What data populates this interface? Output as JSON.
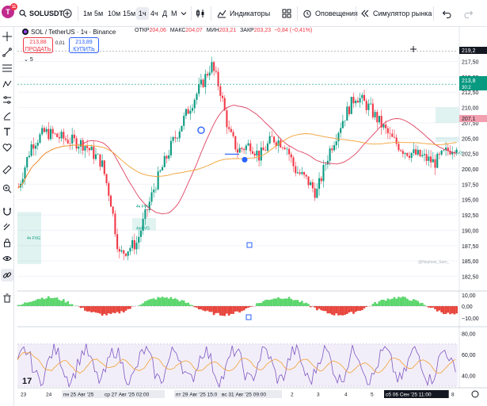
{
  "topbar": {
    "avatar_letter": "T",
    "badge": "11",
    "symbol": "SOLUSDT",
    "intervals": [
      "1м",
      "5м",
      "10м",
      "15м",
      "1ч",
      "4ч"
    ],
    "active_interval": "1ч",
    "extra_a": "Д",
    "extra_m": "М",
    "indicators_label": "Индикаторы",
    "alerts_label": "Оповещения",
    "replay_label": "Симулятор рынка"
  },
  "legend": {
    "title": "SOL / TetherUS · 1ч · Binance",
    "open_label": "ОТКР",
    "open": "204,06",
    "high_label": "МАКС",
    "high": "204,07",
    "low_label": "МИН",
    "low": "203,21",
    "close_label": "ЗАКР",
    "close": "203,23",
    "change": "−0,84 (−0,41%)",
    "sell_price": "213,88",
    "sell_label": "ПРОДАТЬ",
    "spread": "0,01",
    "buy_price": "213,89",
    "buy_label": "КУПИТЬ",
    "indicator_count": "5"
  },
  "price_axis": {
    "ticks": [
      "217,50",
      "215,00",
      "212,50",
      "210,00",
      "207,50",
      "205,00",
      "202,50",
      "200,00",
      "197,50",
      "195,00",
      "192,50",
      "190,00",
      "187,50",
      "185,00",
      "182,50"
    ],
    "current_price": "213,8",
    "countdown": "30:2",
    "top_price": "219,2",
    "ma_label": "207,1",
    "colors": {
      "bull": "#089981",
      "bear": "#f23645",
      "price_tag": "#089981",
      "ma_fast": "#e04060",
      "ma_slow": "#f2a033",
      "accent": "#2962ff"
    }
  },
  "fvg_labels": [
    "4ч FVG",
    "4ч FVG",
    "4ч FVG",
    "4ч FVG"
  ],
  "watermark": "@Nephew_Sam_",
  "oscillator_axis": [
    "10,00",
    "0,00",
    "−10,00"
  ],
  "rsi_axis": [
    "80,00",
    "60,00",
    "40,00"
  ],
  "time_axis": [
    "23",
    "24",
    "пн 25 Авг '25",
    "ср 27 Авг '25  02:00",
    "пт 29 Авг '25  15:0",
    "вс 31 Авг '25  09:00",
    "2",
    "3",
    "4",
    "5",
    "сб 06 Сен '25   11:00",
    "7",
    "8"
  ],
  "logo_text": "17"
}
